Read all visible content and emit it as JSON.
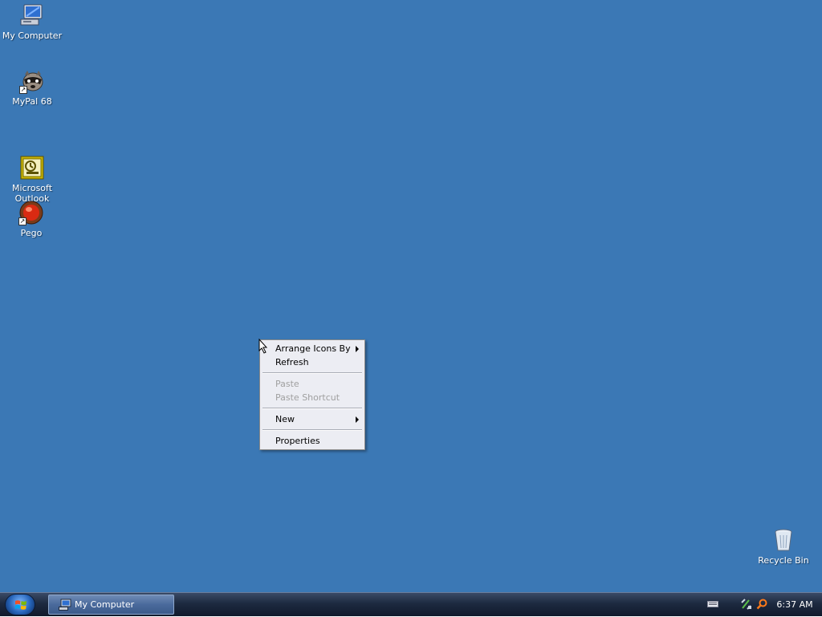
{
  "desktop": {
    "background_color": "#3b78b5",
    "icons": [
      {
        "label": "My Computer",
        "icon": "my-computer-icon"
      },
      {
        "label": "MyPal 68",
        "icon": "mypal-raccoon-icon"
      },
      {
        "label": "Microsoft\nOutlook",
        "icon": "outlook-icon"
      },
      {
        "label": "Pego",
        "icon": "pego-icon"
      },
      {
        "label": "Recycle Bin",
        "icon": "recycle-bin-icon"
      }
    ]
  },
  "context_menu": {
    "items": [
      {
        "label": "Arrange Icons By",
        "enabled": true,
        "submenu": true
      },
      {
        "label": "Refresh",
        "enabled": true,
        "submenu": false
      },
      {
        "label": "Paste",
        "enabled": false,
        "submenu": false
      },
      {
        "label": "Paste Shortcut",
        "enabled": false,
        "submenu": false
      },
      {
        "label": "New",
        "enabled": true,
        "submenu": true
      },
      {
        "label": "Properties",
        "enabled": true,
        "submenu": false
      }
    ]
  },
  "taskbar": {
    "start_icon": "windows-orb-icon",
    "tasks": [
      {
        "label": "My Computer",
        "icon": "my-computer-icon"
      }
    ],
    "tray_icons": [
      "keyboard-icon",
      "network-icon",
      "search-icon"
    ],
    "clock": "6:37 AM"
  }
}
